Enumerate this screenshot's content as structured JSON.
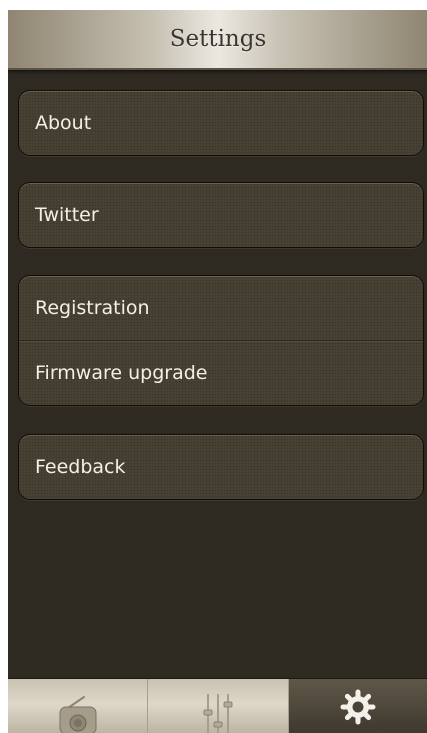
{
  "header": {
    "title": "Settings"
  },
  "settings": {
    "groups": [
      {
        "items": [
          {
            "label": "About"
          }
        ]
      },
      {
        "items": [
          {
            "label": "Twitter"
          }
        ]
      },
      {
        "items": [
          {
            "label": "Registration"
          },
          {
            "label": "Firmware upgrade"
          }
        ]
      },
      {
        "items": [
          {
            "label": "Feedback"
          }
        ]
      }
    ]
  },
  "tabbar": {
    "tabs": [
      {
        "icon": "radio-icon",
        "active": false
      },
      {
        "icon": "equalizer-sliders-icon",
        "active": false
      },
      {
        "icon": "gear-icon",
        "active": true
      }
    ]
  },
  "colors": {
    "background": "#2e2a22",
    "cell_fill": "#4b4536",
    "text": "#f2efe6",
    "header_text": "#3b362e"
  }
}
